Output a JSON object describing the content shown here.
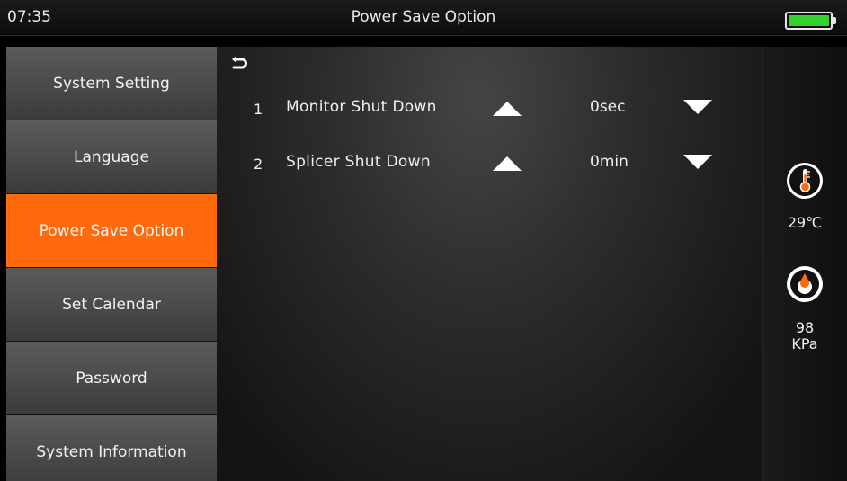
{
  "status": {
    "time": "07:35",
    "title": "Power Save Option",
    "battery_icon": "battery-full-icon",
    "battery_color": "#32d12e"
  },
  "sidebar": {
    "items": [
      {
        "label": "System Setting",
        "active": false
      },
      {
        "label": "Language",
        "active": false
      },
      {
        "label": "Power Save Option",
        "active": true
      },
      {
        "label": "Set Calendar",
        "active": false
      },
      {
        "label": "Password",
        "active": false
      },
      {
        "label": "System Information",
        "active": false
      }
    ],
    "active_color": "#ff6a0d"
  },
  "main": {
    "back_icon": "back-arrow-icon",
    "rows": [
      {
        "number": "1",
        "label": "Monitor Shut Down",
        "value": "0sec"
      },
      {
        "number": "2",
        "label": "Splicer Shut Down",
        "value": "0min"
      }
    ]
  },
  "sensors": {
    "temperature": {
      "icon": "thermometer-icon",
      "value": "29℃"
    },
    "pressure": {
      "icon": "pressure-gauge-icon",
      "value": "98",
      "unit": "KPa"
    }
  }
}
